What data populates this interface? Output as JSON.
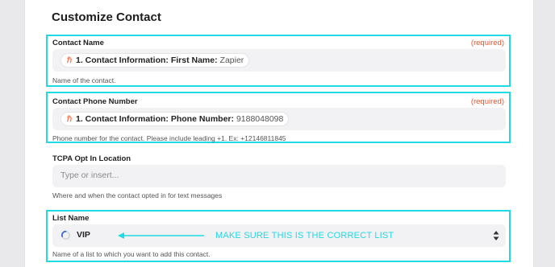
{
  "section_title": "Customize Contact",
  "accent_color": "#1fd9e6",
  "required_color": "#e0552b",
  "fields": {
    "contact_name": {
      "label": "Contact Name",
      "required": "(required)",
      "pill_step": "1. Contact Information: First Name:",
      "pill_value": "Zapier",
      "help": "Name of the contact."
    },
    "contact_phone": {
      "label": "Contact Phone Number",
      "required": "(required)",
      "pill_step": "1. Contact Information: Phone Number:",
      "pill_value": "9188048098",
      "help": "Phone number for the contact. Please include leading +1. Ex: +12146811845"
    },
    "tcpa": {
      "label": "TCPA Opt In Location",
      "placeholder": "Type or insert...",
      "help": "Where and when the contact opted in for text messages"
    },
    "list_name": {
      "label": "List Name",
      "value": "VIP",
      "annotation": "MAKE SURE THIS IS THE CORRECT LIST",
      "help": "Name of a list to which you want to add this contact."
    }
  },
  "icons": {
    "pill_app_icon": "hubspot-icon",
    "list_icon": "loading-spinner-icon",
    "select_caret": "sort-caret-icon",
    "annotation_arrow": "arrow-left-icon"
  }
}
